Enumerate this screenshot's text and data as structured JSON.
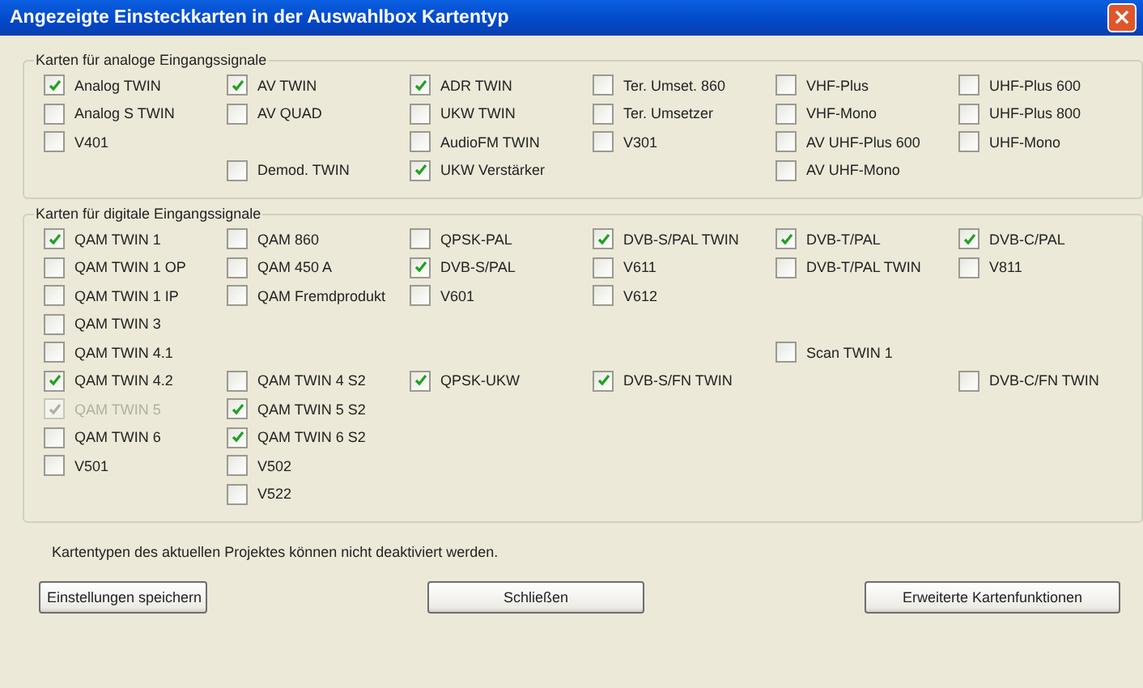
{
  "window": {
    "title": "Angezeigte Einsteckkarten in der Auswahlbox Kartentyp",
    "close": "×"
  },
  "groups": [
    {
      "title": "Karten für analoge Eingangssignale",
      "rows": [
        [
          {
            "label": "Analog TWIN",
            "checked": true,
            "disabled": false
          },
          {
            "label": "AV TWIN",
            "checked": true,
            "disabled": false
          },
          {
            "label": "ADR TWIN",
            "checked": true,
            "disabled": false
          },
          {
            "label": "Ter. Umset. 860",
            "checked": false,
            "disabled": false
          },
          {
            "label": "VHF-Plus",
            "checked": false,
            "disabled": false
          },
          {
            "label": "UHF-Plus 600",
            "checked": false,
            "disabled": false
          }
        ],
        [
          {
            "label": "Analog S TWIN",
            "checked": false,
            "disabled": false
          },
          {
            "label": "AV QUAD",
            "checked": false,
            "disabled": false
          },
          {
            "label": "UKW TWIN",
            "checked": false,
            "disabled": false
          },
          {
            "label": "Ter. Umsetzer",
            "checked": false,
            "disabled": false
          },
          {
            "label": "VHF-Mono",
            "checked": false,
            "disabled": false
          },
          {
            "label": "UHF-Plus 800",
            "checked": false,
            "disabled": false
          }
        ],
        [
          {
            "label": "V401",
            "checked": false,
            "disabled": false
          },
          null,
          {
            "label": "AudioFM TWIN",
            "checked": false,
            "disabled": false
          },
          {
            "label": "V301",
            "checked": false,
            "disabled": false
          },
          {
            "label": "AV UHF-Plus 600",
            "checked": false,
            "disabled": false
          },
          {
            "label": "UHF-Mono",
            "checked": false,
            "disabled": false
          }
        ],
        [
          null,
          {
            "label": "Demod. TWIN",
            "checked": false,
            "disabled": false
          },
          {
            "label": "UKW Verstärker",
            "checked": true,
            "disabled": false
          },
          null,
          {
            "label": "AV UHF-Mono",
            "checked": false,
            "disabled": false
          },
          null
        ]
      ]
    },
    {
      "title": "Karten für digitale Eingangssignale",
      "rows": [
        [
          {
            "label": "QAM TWIN 1",
            "checked": true,
            "disabled": false
          },
          {
            "label": "QAM 860",
            "checked": false,
            "disabled": false
          },
          {
            "label": "QPSK-PAL",
            "checked": false,
            "disabled": false
          },
          {
            "label": "DVB-S/PAL TWIN",
            "checked": true,
            "disabled": false
          },
          {
            "label": "DVB-T/PAL",
            "checked": true,
            "disabled": false
          },
          {
            "label": "DVB-C/PAL",
            "checked": true,
            "disabled": false
          }
        ],
        [
          {
            "label": "QAM TWIN 1 OP",
            "checked": false,
            "disabled": false
          },
          {
            "label": "QAM 450 A",
            "checked": false,
            "disabled": false
          },
          {
            "label": "DVB-S/PAL",
            "checked": true,
            "disabled": false
          },
          {
            "label": "V611",
            "checked": false,
            "disabled": false
          },
          {
            "label": "DVB-T/PAL TWIN",
            "checked": false,
            "disabled": false
          },
          {
            "label": "V811",
            "checked": false,
            "disabled": false
          }
        ],
        [
          {
            "label": "QAM TWIN 1 IP",
            "checked": false,
            "disabled": false
          },
          {
            "label": "QAM Fremdprodukt",
            "checked": false,
            "disabled": false
          },
          {
            "label": "V601",
            "checked": false,
            "disabled": false
          },
          {
            "label": "V612",
            "checked": false,
            "disabled": false
          },
          null,
          null
        ],
        [
          {
            "label": "QAM TWIN 3",
            "checked": false,
            "disabled": false
          },
          null,
          null,
          null,
          null,
          null
        ],
        [
          {
            "label": "QAM TWIN 4.1",
            "checked": false,
            "disabled": false
          },
          null,
          null,
          null,
          {
            "label": "Scan TWIN 1",
            "checked": false,
            "disabled": false
          },
          null
        ],
        [
          {
            "label": "QAM TWIN 4.2",
            "checked": true,
            "disabled": false
          },
          {
            "label": "QAM TWIN 4 S2",
            "checked": false,
            "disabled": false
          },
          {
            "label": "QPSK-UKW",
            "checked": true,
            "disabled": false
          },
          {
            "label": "DVB-S/FN TWIN",
            "checked": true,
            "disabled": false
          },
          null,
          {
            "label": "DVB-C/FN TWIN",
            "checked": false,
            "disabled": false
          }
        ],
        [
          {
            "label": "QAM TWIN 5",
            "checked": true,
            "disabled": true
          },
          {
            "label": "QAM TWIN 5 S2",
            "checked": true,
            "disabled": false
          },
          null,
          null,
          null,
          null
        ],
        [
          {
            "label": "QAM TWIN 6",
            "checked": false,
            "disabled": false
          },
          {
            "label": "QAM TWIN 6 S2",
            "checked": true,
            "disabled": false
          },
          null,
          null,
          null,
          null
        ],
        [
          {
            "label": "V501",
            "checked": false,
            "disabled": false
          },
          {
            "label": "V502",
            "checked": false,
            "disabled": false
          },
          null,
          null,
          null,
          null
        ],
        [
          null,
          {
            "label": "V522",
            "checked": false,
            "disabled": false
          },
          null,
          null,
          null,
          null
        ]
      ]
    }
  ],
  "note": "Kartentypen des aktuellen Projektes können nicht deaktiviert werden.",
  "buttons": [
    "Einstellungen speichern",
    "Schließen",
    "Erweiterte Kartenfunktionen"
  ]
}
